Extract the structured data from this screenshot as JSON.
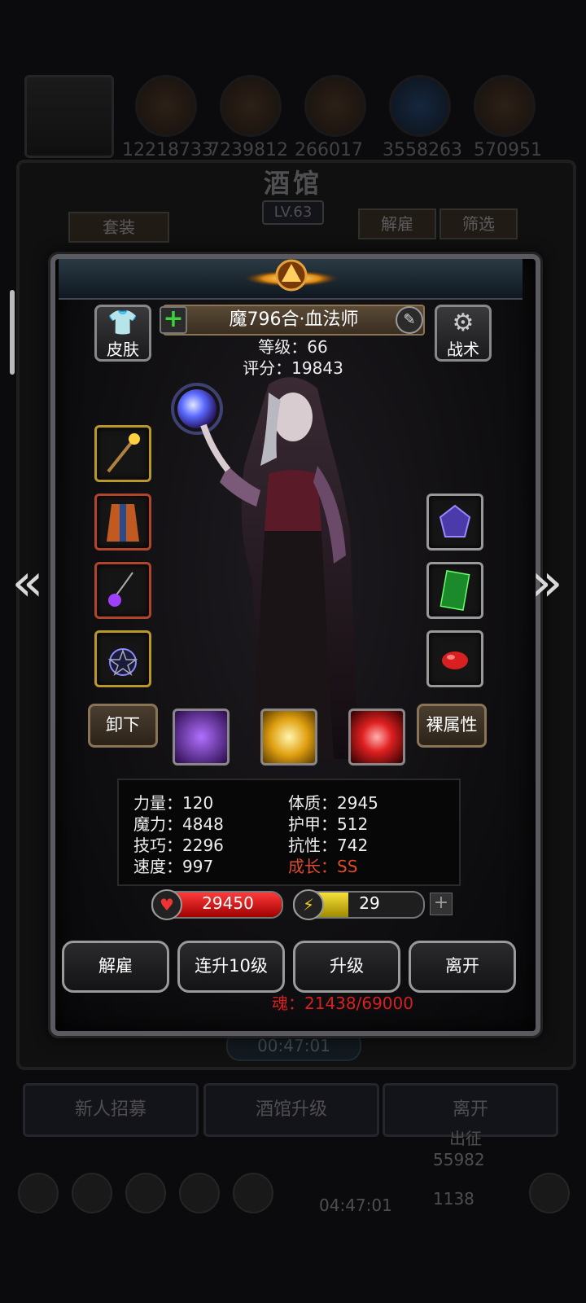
{
  "background": {
    "resources": [
      "12218733",
      "7239812",
      "266017",
      "3558263",
      "570951"
    ],
    "tavern_title": "酒馆",
    "tavern_level": "LV.63",
    "set_button": "套装",
    "dismiss_button": "解雇",
    "filter_button": "筛选",
    "timer": "00:47:01",
    "bottom_buttons": [
      "新人招募",
      "酒馆升级",
      "离开"
    ],
    "expedition": "出征",
    "currency_a": "55982",
    "currency_b": "1138",
    "timer2": "04:47:01"
  },
  "hero": {
    "skin_label": "皮肤",
    "tactics_label": "战术",
    "name": "魔796合·血法师",
    "level_line": "等级：66",
    "score_line": "评分：19843",
    "unequip_label": "卸下",
    "naked_attr_label": "裸属性",
    "attributes_left": [
      "力量：120",
      "魔力：4848",
      "技巧：2296",
      "速度：997"
    ],
    "attributes_right": [
      "体质：2945",
      "护甲：512",
      "抗性：742"
    ],
    "growth_line": "成长：SS",
    "hp": "29450",
    "hp_fraction": 1.0,
    "energy": "29",
    "energy_fraction": 0.42,
    "soul_line": "魂：21438/69000"
  },
  "actions": {
    "dismiss": "解雇",
    "level_up_10": "连升10级",
    "level_up": "升级",
    "leave": "离开"
  },
  "equipment_left": [
    "staff",
    "robe",
    "amulet",
    "pentagram-amulet"
  ],
  "equipment_right": [
    "purple-gem",
    "green-spellbook",
    "red-gem"
  ],
  "skills": [
    "purple-shadow-skill",
    "golden-burst-skill",
    "red-slash-skill"
  ],
  "colors": {
    "growth": "#e04a2a",
    "soul": "#d82020",
    "hp": "#d81818",
    "energy": "#e8d020"
  }
}
